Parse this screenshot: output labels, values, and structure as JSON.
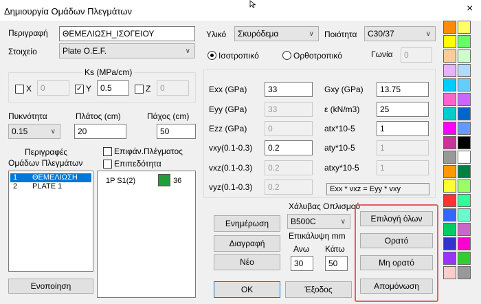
{
  "window": {
    "title": "Δημιουργία Ομάδων Πλεγμάτων",
    "close_glyph": "×"
  },
  "left": {
    "description_label": "Περιγραφή",
    "description_value": "ΘΕΜΕΛΙΩΣΗ_ΙΣΟΓΕΙΟΥ",
    "element_label": "Στοιχείο",
    "element_value": "Plate O.E.F.",
    "ks_label": "Ks (MPa/cm)",
    "ks": [
      {
        "axis": "X",
        "checked": false,
        "value": "0"
      },
      {
        "axis": "Y",
        "checked": true,
        "value": "0.5"
      },
      {
        "axis": "Z",
        "checked": false,
        "value": "0"
      }
    ],
    "density_label": "Πυκνότητα",
    "density_value": "0.15",
    "width_label": "Πλάτος (cm)",
    "width_value": "20",
    "thickness_label": "Πάχος (cm)",
    "thickness_value": "50",
    "groups_desc_label_1": "Περιγραφές",
    "groups_desc_label_2": "Ομάδων Πλεγμάτων",
    "mesh_surface_label": "Επιφάν.Πλέγματος",
    "flatness_label": "Επιπεδότητα",
    "groups": [
      {
        "num": "1",
        "name": "ΘΕΜΕΛΙΩΣΗ",
        "selected": true
      },
      {
        "num": "2",
        "name": "PLATE 1",
        "selected": false
      }
    ],
    "mesh_items": [
      {
        "label": "1P S1(2)",
        "color": "#1e9f3a",
        "count": "36"
      }
    ],
    "merge_button": "Ενοποίηση"
  },
  "material": {
    "material_label": "Υλικό",
    "material_value": "Σκυρόδεμα",
    "quality_label": "Ποιότητα",
    "quality_value": "C30/37",
    "isotropic_label": "Ισοτροπικό",
    "orthotropic_label": "Ορθοτροπικό",
    "isotropic_selected": true,
    "angle_label": "Γωνία",
    "angle_value": "0",
    "props_left": [
      {
        "label": "Exx (GPa)",
        "value": "33",
        "enabled": true
      },
      {
        "label": "Eyy (GPa)",
        "value": "33",
        "enabled": false
      },
      {
        "label": "Ezz (GPa)",
        "value": "0",
        "enabled": false
      },
      {
        "label": "vxy(0.1-0.3)",
        "value": "0.2",
        "enabled": true
      },
      {
        "label": "vxz(0.1-0.3)",
        "value": "0.2",
        "enabled": false
      },
      {
        "label": "vyz(0.1-0.3)",
        "value": "0.2",
        "enabled": false
      }
    ],
    "props_right": [
      {
        "label": "Gxy (GPa)",
        "value": "13.75",
        "enabled": true
      },
      {
        "label": "ε (kN/m3)",
        "value": "25",
        "enabled": true
      },
      {
        "label": "atx*10-5",
        "value": "1",
        "enabled": true
      },
      {
        "label": "aty*10-5",
        "value": "1",
        "enabled": false
      },
      {
        "label": "atxy*10-5",
        "value": "1",
        "enabled": false
      }
    ],
    "equation": "Exx * vxz = Eyy * vxy"
  },
  "bottom": {
    "update_button": "Ενημέρωση",
    "delete_button": "Διαγραφή",
    "new_button": "Νέο",
    "steel_label": "Χάλυβας Οπλισμού",
    "steel_value": "B500C",
    "cover_label": "Επικάλυψη mm",
    "top_label": "Ανω",
    "bottom_label": "Κάτω",
    "top_value": "30",
    "bottom_value": "50",
    "ok_button": "OK",
    "exit_button": "Έξοδος"
  },
  "actions": {
    "select_all": "Επιλογή όλων",
    "visible": "Ορατό",
    "not_visible": "Μη ορατό",
    "isolate": "Απομόνωση"
  },
  "palette": [
    "#ff8c00",
    "#ffff66",
    "#ffff00",
    "#66ff66",
    "#ffcc99",
    "#ccffcc",
    "#e6b3ff",
    "#b3d9ff",
    "#00ccff",
    "#66ccff",
    "#ff66cc",
    "#cc66ff",
    "#00cccc",
    "#0066cc",
    "#ff00ff",
    "#6699ff",
    "#cc3399",
    "#000000",
    "#999999",
    "#ffffff",
    "#ff9900",
    "#008040",
    "#ffff33",
    "#99ff66",
    "#ff3333",
    "#33ff99",
    "#3366ff",
    "#66ffcc",
    "#00cc66",
    "#cc66cc",
    "#3333cc",
    "#ff00cc",
    "#9933ff",
    "#33cc33",
    "#ffcccc",
    "#999999"
  ]
}
